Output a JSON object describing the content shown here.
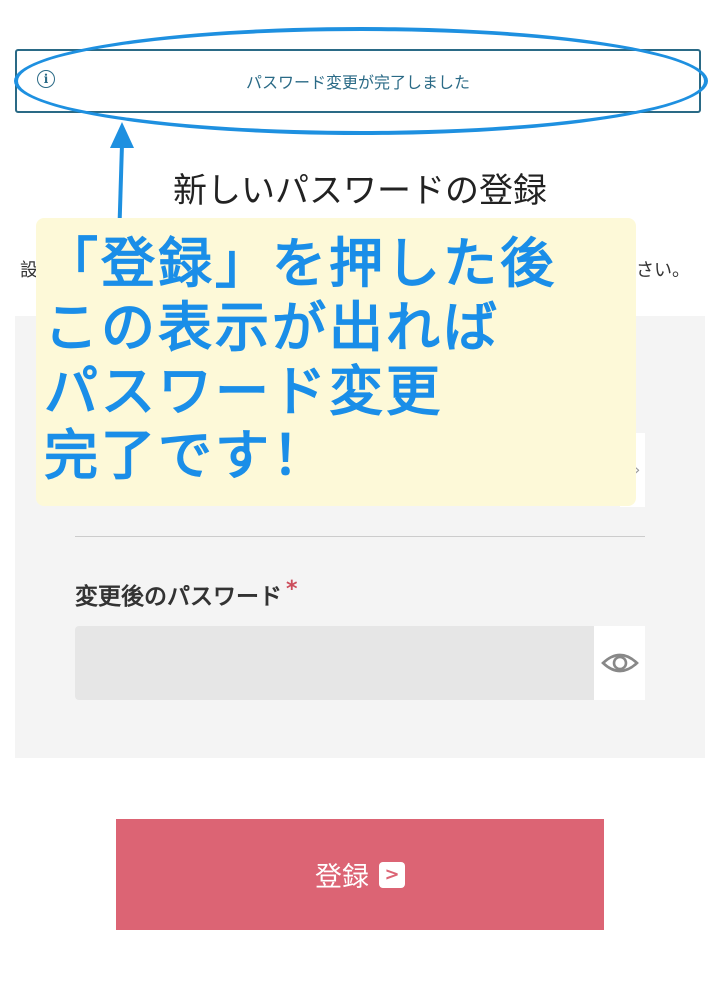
{
  "alert": {
    "message": "パスワード変更が完了しました"
  },
  "page": {
    "title": "新しいパスワードの登録"
  },
  "description": {
    "visible_left": "設",
    "visible_right": "さい。"
  },
  "form": {
    "new_password_label": "変更後のパスワード",
    "required_mark": "*",
    "new_password_value": ""
  },
  "submit": {
    "label": "登録"
  },
  "annotation": {
    "lines": [
      "「登録」を押した後",
      "この表示が出れば",
      "パスワード変更",
      "完了です！"
    ]
  },
  "colors": {
    "accent_blue": "#1e90e0",
    "alert_border": "#2a6a86",
    "button": "#dc6474",
    "required": "#cc4d5b",
    "callout_bg": "#fdf9d8"
  },
  "icons": {
    "alert": "info-icon",
    "password_toggle": "eye-icon",
    "submit": "chevron-right-icon",
    "annotation_arrow": "arrow-up-icon"
  }
}
